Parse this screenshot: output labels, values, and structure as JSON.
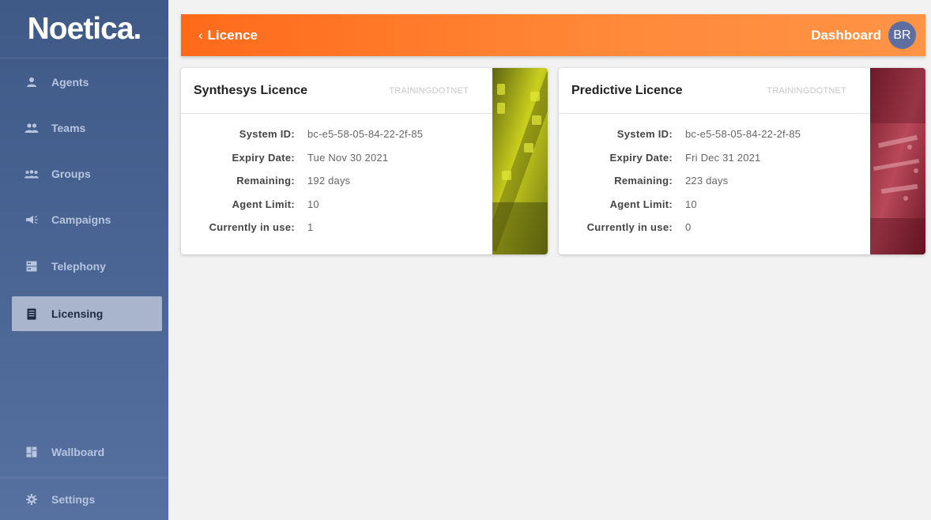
{
  "brand": {
    "logo_text": "Noetica."
  },
  "sidebar": {
    "items": [
      {
        "label": "Agents",
        "icon": "person-icon"
      },
      {
        "label": "Teams",
        "icon": "people-icon"
      },
      {
        "label": "Groups",
        "icon": "group-icon"
      },
      {
        "label": "Campaigns",
        "icon": "megaphone-icon"
      },
      {
        "label": "Telephony",
        "icon": "server-icon"
      },
      {
        "label": "Licensing",
        "icon": "license-icon",
        "active": true
      }
    ],
    "bottom_items": [
      {
        "label": "Wallboard",
        "icon": "dashboard-icon"
      },
      {
        "label": "Settings",
        "icon": "gear-icon"
      }
    ]
  },
  "header": {
    "back_label": "Licence",
    "dashboard_label": "Dashboard",
    "avatar_initials": "BR"
  },
  "labels": {
    "system_id": "System ID:",
    "expiry_date": "Expiry Date:",
    "remaining": "Remaining:",
    "agent_limit": "Agent Limit:",
    "currently_in_use": "Currently in use:"
  },
  "cards": [
    {
      "title": "Synthesys Licence",
      "tag": "TRAININGDOTNET",
      "system_id": "bc-e5-58-05-84-22-2f-85",
      "expiry_date": "Tue Nov 30 2021",
      "remaining": "192 days",
      "agent_limit": "10",
      "currently_in_use": "1"
    },
    {
      "title": "Predictive Licence",
      "tag": "TRAININGDOTNET",
      "system_id": "bc-e5-58-05-84-22-2f-85",
      "expiry_date": "Fri Dec 31 2021",
      "remaining": "223 days",
      "agent_limit": "10",
      "currently_in_use": "0"
    }
  ],
  "colors": {
    "sidebar": "#4b6594",
    "accent_orange": "#ff7a2a",
    "active_item": "#a9b5cc",
    "avatar": "#5d6fa1"
  }
}
